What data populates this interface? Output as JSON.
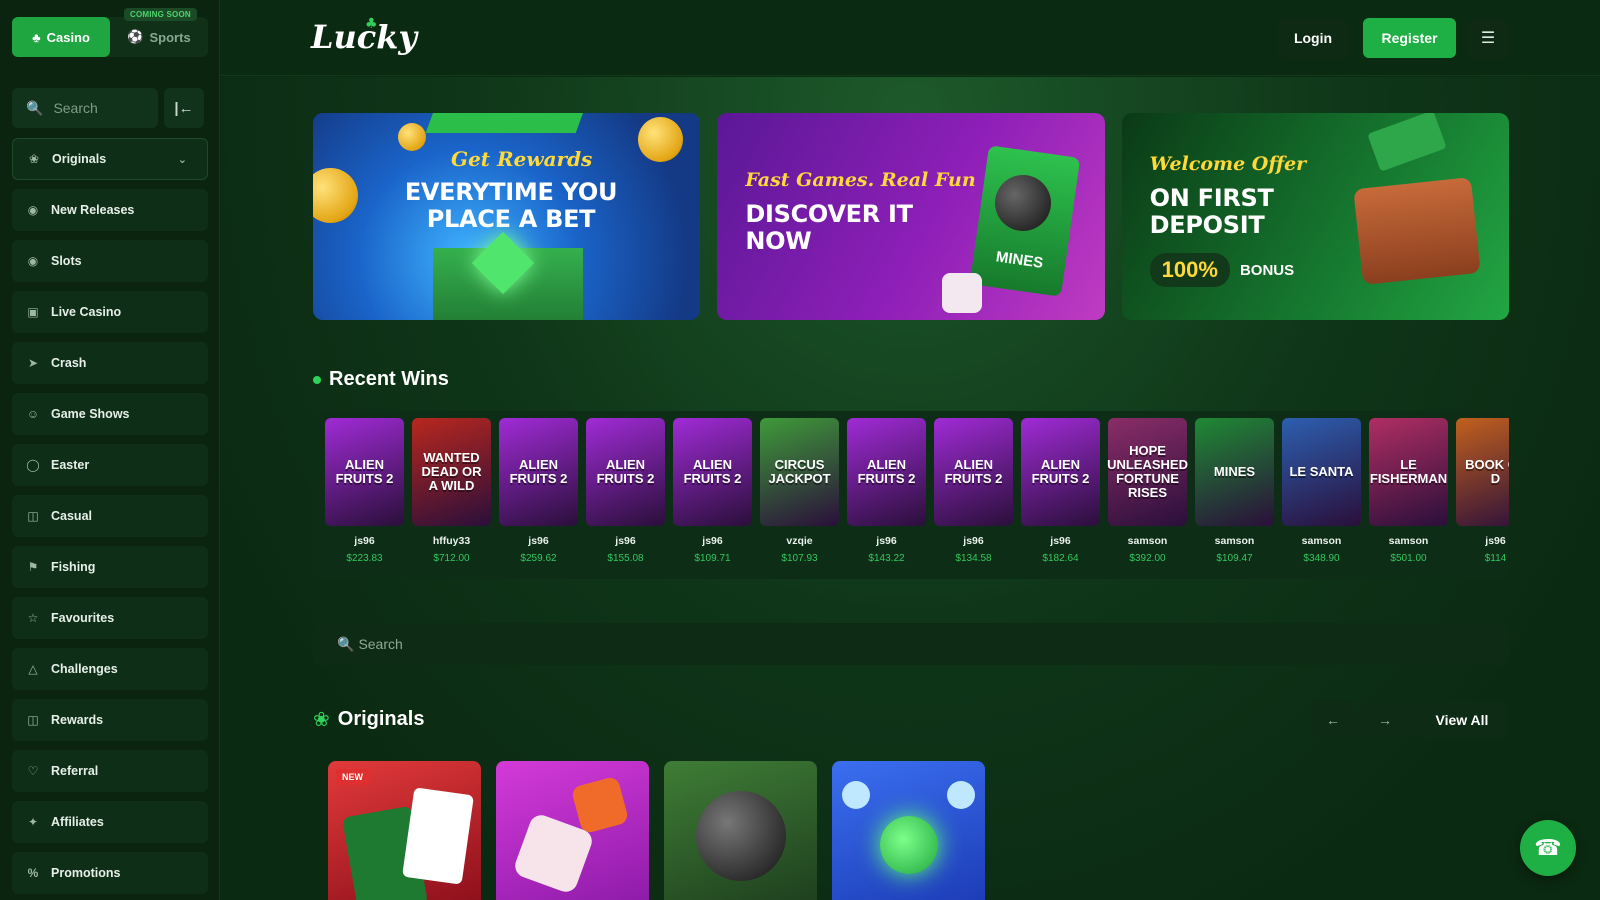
{
  "sidebar": {
    "casino_label": "Casino",
    "sports_label": "Sports",
    "coming_soon": "COMING SOON",
    "search_placeholder": "Search",
    "items": [
      {
        "label": "Originals",
        "icon": "clover-icon"
      },
      {
        "label": "New Releases",
        "icon": "new-icon"
      },
      {
        "label": "Slots",
        "icon": "slots-icon"
      },
      {
        "label": "Live Casino",
        "icon": "live-icon"
      },
      {
        "label": "Crash",
        "icon": "rocket-icon"
      },
      {
        "label": "Game Shows",
        "icon": "host-icon"
      },
      {
        "label": "Easter",
        "icon": "egg-icon"
      },
      {
        "label": "Casual",
        "icon": "cube-icon"
      },
      {
        "label": "Fishing",
        "icon": "fish-icon"
      },
      {
        "label": "Favourites",
        "icon": "star-icon"
      },
      {
        "label": "Challenges",
        "icon": "triangle-icon"
      },
      {
        "label": "Rewards",
        "icon": "gift-icon"
      },
      {
        "label": "Referral",
        "icon": "heart-icon"
      },
      {
        "label": "Affiliates",
        "icon": "network-icon"
      },
      {
        "label": "Promotions",
        "icon": "percent-icon"
      }
    ]
  },
  "header": {
    "logo": "Lucky",
    "login": "Login",
    "register": "Register"
  },
  "banners": [
    {
      "script": "Get Rewards",
      "line1": "EVERYTIME YOU",
      "line2": "PLACE A BET"
    },
    {
      "script": "Fast Games. Real Fun",
      "line1": "DISCOVER IT",
      "line2": "NOW",
      "tag": "MINES"
    },
    {
      "script": "Welcome Offer",
      "line1": "ON FIRST",
      "line2": "DEPOSIT",
      "pct": "100%",
      "bonus": "BONUS"
    }
  ],
  "recent_wins": {
    "title": "Recent Wins",
    "items": [
      {
        "game": "ALIEN FRUITS 2",
        "user": "js96",
        "amount": "$223.83",
        "color": "#a02bd6"
      },
      {
        "game": "WANTED DEAD OR A WILD",
        "user": "hffuy33",
        "amount": "$712.00",
        "color": "#b8271e"
      },
      {
        "game": "ALIEN FRUITS 2",
        "user": "js96",
        "amount": "$259.62",
        "color": "#a02bd6"
      },
      {
        "game": "ALIEN FRUITS 2",
        "user": "js96",
        "amount": "$155.08",
        "color": "#a02bd6"
      },
      {
        "game": "ALIEN FRUITS 2",
        "user": "js96",
        "amount": "$109.71",
        "color": "#a02bd6"
      },
      {
        "game": "CIRCUS JACKPOT",
        "user": "vzqie",
        "amount": "$107.93",
        "color": "#3f9a3a"
      },
      {
        "game": "ALIEN FRUITS 2",
        "user": "js96",
        "amount": "$143.22",
        "color": "#a02bd6"
      },
      {
        "game": "ALIEN FRUITS 2",
        "user": "js96",
        "amount": "$134.58",
        "color": "#a02bd6"
      },
      {
        "game": "ALIEN FRUITS 2",
        "user": "js96",
        "amount": "$182.64",
        "color": "#a02bd6"
      },
      {
        "game": "HOPE UNLEASHED FORTUNE RISES",
        "user": "samson",
        "amount": "$392.00",
        "color": "#8a2d68"
      },
      {
        "game": "MINES",
        "user": "samson",
        "amount": "$109.47",
        "color": "#1f8a34"
      },
      {
        "game": "LE SANTA",
        "user": "samson",
        "amount": "$348.90",
        "color": "#2c5fb0"
      },
      {
        "game": "LE FISHERMAN",
        "user": "samson",
        "amount": "$501.00",
        "color": "#b02e63"
      },
      {
        "game": "BOOK OF D",
        "user": "js96",
        "amount": "$114",
        "color": "#c2601e"
      }
    ]
  },
  "main_search_placeholder": "Search",
  "originals": {
    "title": "Originals",
    "view_all": "View All",
    "new_badge": "NEW"
  }
}
